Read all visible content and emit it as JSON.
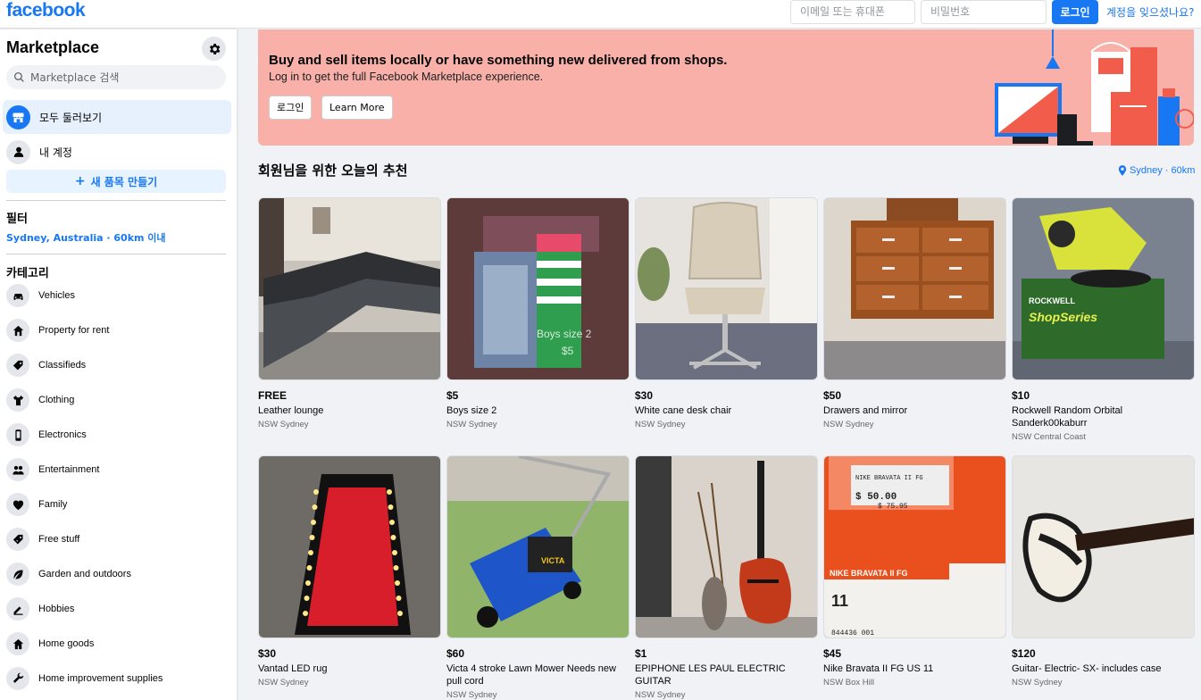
{
  "topbar": {
    "logo": "facebook",
    "email_placeholder": "이메일 또는 휴대폰",
    "password_placeholder": "비밀번호",
    "login_label": "로그인",
    "forgot_label": "계정을 잊으셨나요?"
  },
  "sidebar": {
    "title": "Marketplace",
    "search_placeholder": "Marketplace 검색",
    "nav": [
      {
        "label": "모두 둘러보기",
        "icon": "storefront-icon"
      },
      {
        "label": "내 계정",
        "icon": "person-icon"
      }
    ],
    "new_listing": "새 품목 만들기",
    "filter_title": "필터",
    "filter_location": "Sydney, Australia · 60km 이내",
    "categories_title": "카테고리",
    "categories": [
      {
        "label": "Vehicles",
        "icon": "car-icon"
      },
      {
        "label": "Property for rent",
        "icon": "house-icon"
      },
      {
        "label": "Classifieds",
        "icon": "tag-icon"
      },
      {
        "label": "Clothing",
        "icon": "shirt-icon"
      },
      {
        "label": "Electronics",
        "icon": "phone-icon"
      },
      {
        "label": "Entertainment",
        "icon": "people-icon"
      },
      {
        "label": "Family",
        "icon": "heart-icon"
      },
      {
        "label": "Free stuff",
        "icon": "free-tag-icon"
      },
      {
        "label": "Garden and outdoors",
        "icon": "leaf-icon"
      },
      {
        "label": "Hobbies",
        "icon": "pencil-icon"
      },
      {
        "label": "Home goods",
        "icon": "home-icon"
      },
      {
        "label": "Home improvement supplies",
        "icon": "wrench-icon"
      }
    ]
  },
  "banner": {
    "heading": "Buy and sell items locally or have something new delivered from shops.",
    "subtext": "Log in to get the full Facebook Marketplace experience.",
    "login_label": "로그인",
    "learn_more_label": "Learn More"
  },
  "recommendations": {
    "title": "회원님을 위한 오늘의 추천",
    "location": "Sydney · 60km",
    "listings": [
      {
        "price": "FREE",
        "title": "Leather lounge",
        "location": "NSW Sydney"
      },
      {
        "price": "$5",
        "title": "Boys size 2",
        "location": "NSW Sydney",
        "image_text": [
          "Boys size 2",
          "$5"
        ]
      },
      {
        "price": "$30",
        "title": "White cane desk chair",
        "location": "NSW Sydney"
      },
      {
        "price": "$50",
        "title": "Drawers and mirror",
        "location": "NSW Sydney"
      },
      {
        "price": "$10",
        "title": "Rockwell Random Orbital Sanderk00kaburr",
        "location": "NSW Central Coast",
        "image_text": [
          "ROCKWELL",
          "ShopSeries"
        ]
      },
      {
        "price": "$30",
        "title": "Vantad LED rug",
        "location": "NSW Sydney"
      },
      {
        "price": "$60",
        "title": "Victa 4 stroke Lawn Mower Needs new pull cord",
        "location": "NSW Sydney",
        "image_text": [
          "VICTA"
        ]
      },
      {
        "price": "$1",
        "title": "EPIPHONE LES PAUL ELECTRIC GUITAR",
        "location": "NSW Sydney"
      },
      {
        "price": "$45",
        "title": "Nike Bravata II FG US 11",
        "location": "NSW Box Hill",
        "image_text": [
          "NIKE BRAVATA II FG",
          "$ 50.00",
          "$ 75.95",
          "11",
          "844436 001"
        ]
      },
      {
        "price": "$120",
        "title": "Guitar- Electric- SX- includes case",
        "location": "NSW Sydney"
      }
    ]
  },
  "colors": {
    "brand": "#1877f2",
    "banner_bg": "#f8b0a8",
    "page_bg": "#f0f2f5"
  }
}
